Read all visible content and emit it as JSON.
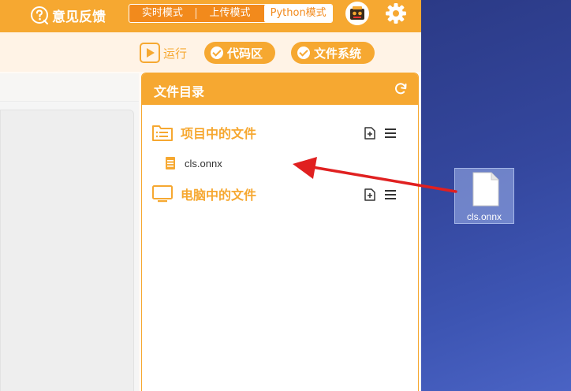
{
  "topbar": {
    "feedback_label": "意见反馈",
    "modes": [
      "实时模式",
      "上传模式",
      "Python模式"
    ],
    "active_mode": "Python模式"
  },
  "toolbar": {
    "run_label": "运行",
    "code_label": "代码区",
    "filesystem_label": "文件系统"
  },
  "file_panel": {
    "title": "文件目录",
    "project_section": "项目中的文件",
    "project_files": [
      "cls.onnx"
    ],
    "computer_section": "电脑中的文件"
  },
  "desktop": {
    "file_name": "cls.onnx"
  },
  "colors": {
    "accent": "#f6a831",
    "accent_dark": "#f28a1c",
    "arrow": "#e02020"
  }
}
